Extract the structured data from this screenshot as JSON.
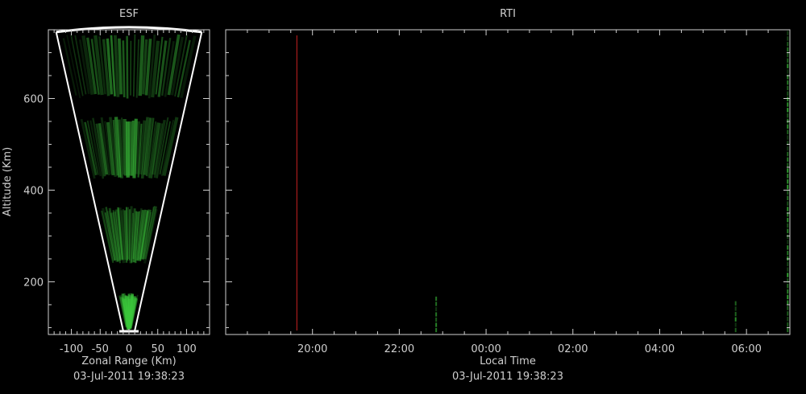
{
  "chart_data": [
    {
      "type": "heatmap",
      "title": "ESF",
      "xlabel": "Zonal Range (Km)",
      "ylabel": "Altitude (Km)",
      "subtitle": "03-Jul-2011 19:38:23",
      "xlim": [
        -140,
        140
      ],
      "ylim": [
        85,
        750
      ],
      "xticks": [
        -100,
        -50,
        0,
        50,
        100
      ],
      "yticks": [
        200,
        400,
        600
      ],
      "xtick_labels": [
        "-100",
        "-50",
        "0",
        "50",
        "100"
      ],
      "ytick_labels": [
        "200",
        "400",
        "600"
      ],
      "wedge": {
        "apex_range": 0,
        "apex_altitude": 85,
        "half_angle_deg": 13.5,
        "max_altitude": 745
      },
      "echo_color": "#3cc83c",
      "echo_bands": [
        {
          "alt_from": 95,
          "alt_to": 175,
          "intensity": 0.9
        },
        {
          "alt_from": 240,
          "alt_to": 365,
          "intensity": 0.75
        },
        {
          "alt_from": 425,
          "alt_to": 560,
          "intensity": 0.8
        },
        {
          "alt_from": 600,
          "alt_to": 740,
          "intensity": 0.8
        }
      ]
    },
    {
      "type": "heatmap",
      "title": "RTI",
      "xlabel": "Local Time",
      "subtitle": "03-Jul-2011 19:38:23",
      "xlim": [
        18.0,
        31.0
      ],
      "ylim": [
        85,
        750
      ],
      "xticks": [
        20,
        22,
        24,
        26,
        28,
        30
      ],
      "xtick_labels": [
        "20:00",
        "22:00",
        "00:00",
        "02:00",
        "04:00",
        "06:00"
      ],
      "yticks": [
        200,
        400,
        600
      ],
      "current_time_marker": {
        "time": 19.64,
        "color": "#cc2222"
      },
      "echo_color": "#3cc83c",
      "echo_traces": [
        {
          "time": 22.85,
          "alt_from": 90,
          "alt_to": 170
        },
        {
          "time": 29.75,
          "alt_from": 90,
          "alt_to": 160
        },
        {
          "time": 30.95,
          "alt_from": 90,
          "alt_to": 750
        }
      ]
    }
  ]
}
